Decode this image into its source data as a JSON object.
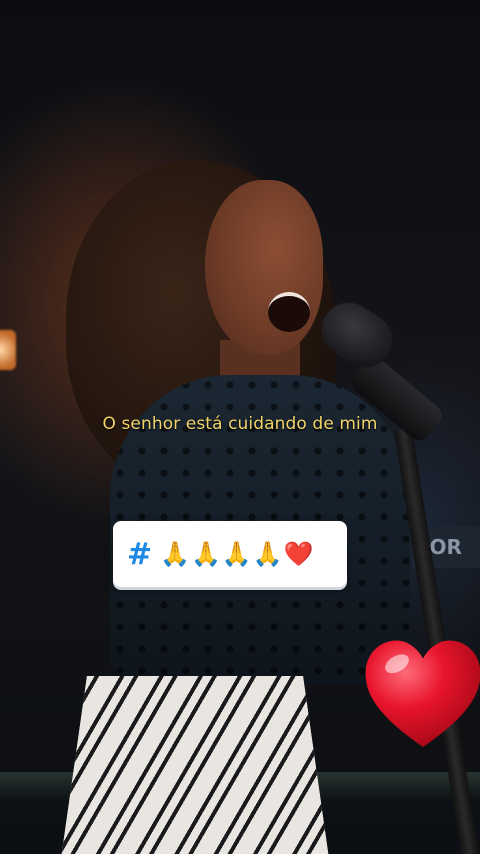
{
  "caption": {
    "lyric": "O senhor está cuidando de mim"
  },
  "sticker": {
    "hashtag_symbol": "#",
    "emojis": "🙏🙏🙏🙏❤️"
  },
  "background_sign": {
    "text": "IOR"
  },
  "colors": {
    "lyric_text": "#f1d36a",
    "hashtag_blue": "#1e88e5",
    "heart_red": "#e8142b"
  },
  "icons": {
    "big_heart": "heart-icon"
  }
}
